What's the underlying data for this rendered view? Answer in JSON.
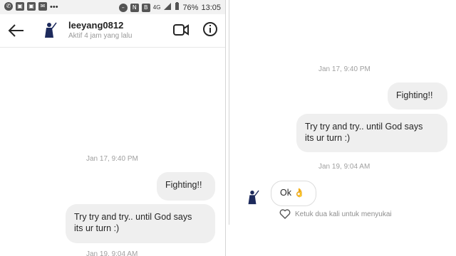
{
  "status_bar": {
    "icons": [
      "whatsapp-icon",
      "image-icon",
      "image-icon",
      "mail-icon",
      "dots-icon"
    ],
    "right_icons": [
      "do-not-disturb-icon",
      "nfc-icon",
      "b-icon",
      "network-4g-icon",
      "signal-icon"
    ],
    "battery": "76%",
    "time": "13:05"
  },
  "header": {
    "username": "leeyang0812",
    "activity": "Aktif 4 jam yang lalu"
  },
  "left": {
    "timestamp1": "Jan 17, 9:40 PM",
    "msg1": "Fighting!!",
    "msg2_line1": "Try try and try.. until God says",
    "msg2_line2": "its ur turn :)",
    "timestamp2": "Jan 19, 9:04 AM"
  },
  "right": {
    "timestamp1": "Jan 17, 9:40 PM",
    "msg1": "Fighting!!",
    "msg2_line1": "Try try and try.. until God says",
    "msg2_line2": "its ur turn :)",
    "timestamp2": "Jan 19, 9:04 AM",
    "reply": "Ok",
    "reply_emoji": "👌",
    "like_hint": "Ketuk dua kali untuk menyukai"
  }
}
